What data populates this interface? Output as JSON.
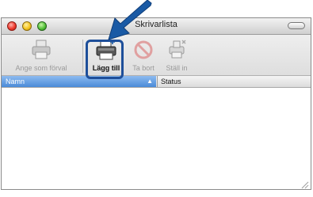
{
  "window": {
    "title": "Skrivarlista"
  },
  "toolbar": {
    "default_label": "Ange som förval",
    "add_label": "Lägg till",
    "delete_label": "Ta bort",
    "setup_label": "Ställ in"
  },
  "columns": {
    "name": "Namn",
    "sort_indicator": "▲",
    "status": "Status"
  },
  "colors": {
    "highlight": "#1e4f9a",
    "arrow": "#1a5aa5",
    "column_selected": "#4a8ad8"
  },
  "icons": [
    "printer-icon",
    "add-printer-icon",
    "delete-icon",
    "setup-icon",
    "callout-arrow",
    "resize-grip-icon"
  ]
}
